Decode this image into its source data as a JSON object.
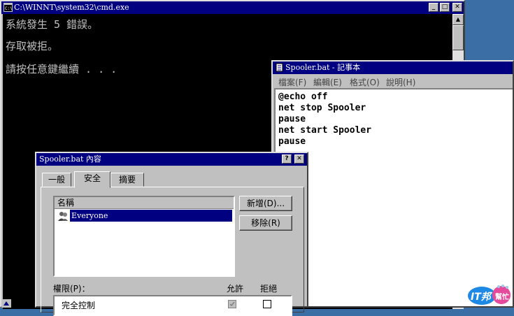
{
  "cmd": {
    "title": "C:\\WINNT\\system32\\cmd.exe",
    "lines": [
      "系統發生 5 錯誤。",
      "存取被拒。",
      "請按任意鍵繼續 . . ."
    ]
  },
  "notepad": {
    "title": "Spooler.bat - 記事本",
    "menu": [
      "檔案(F)",
      "編輯(E)",
      "格式(O)",
      "說明(H)"
    ],
    "lines": [
      "@echo off",
      "net stop Spooler",
      "pause",
      "net start Spooler",
      "pause"
    ]
  },
  "dialog": {
    "title": "Spooler.bat 內容",
    "help_label": "?",
    "tabs": [
      "一般",
      "安全",
      "摘要"
    ],
    "active_tab": "安全",
    "names_header": "名稱",
    "names": [
      "Everyone"
    ],
    "add_button": "新增(D)...",
    "remove_button": "移除(R)",
    "permissions_label": "權限(P)：",
    "allow_header": "允許",
    "deny_header": "拒絕",
    "permissions": [
      {
        "name": "完全控制",
        "allow": true,
        "deny": false
      }
    ]
  },
  "logo": {
    "text": "IT邦",
    "subtext": "幫忙"
  },
  "colors": {
    "titlebar": "#000080",
    "desktop": "#3a6ea5",
    "console_bg": "#000000",
    "console_fg": "#c0c0c0",
    "selection": "#000080"
  }
}
